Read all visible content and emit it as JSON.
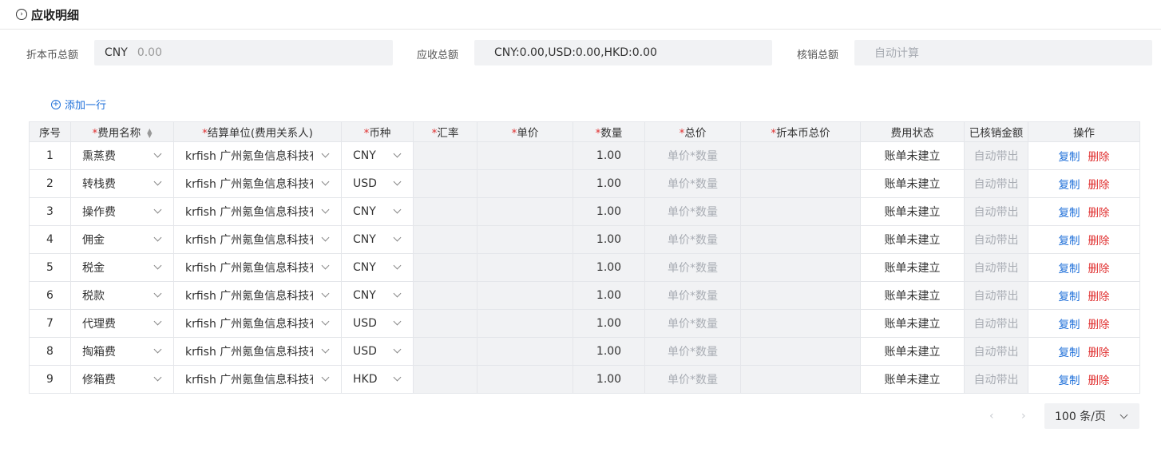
{
  "header": {
    "title": "应收明细"
  },
  "summary": {
    "base_total_label": "折本币总额",
    "base_total_currency": "CNY",
    "base_total_value": "0.00",
    "receivable_total_label": "应收总额",
    "receivable_total_value": "CNY:0.00,USD:0.00,HKD:0.00",
    "writeoff_total_label": "核销总额",
    "writeoff_total_placeholder": "自动计算"
  },
  "add_row_label": "添加一行",
  "table": {
    "columns": [
      {
        "label": "序号",
        "required": false
      },
      {
        "label": "费用名称",
        "required": true
      },
      {
        "label": "结算单位(费用关系人)",
        "required": true
      },
      {
        "label": "币种",
        "required": true
      },
      {
        "label": "汇率",
        "required": true
      },
      {
        "label": "单价",
        "required": true
      },
      {
        "label": "数量",
        "required": true
      },
      {
        "label": "总价",
        "required": true
      },
      {
        "label": "折本币总价",
        "required": true
      },
      {
        "label": "费用状态",
        "required": false
      },
      {
        "label": "已核销金额",
        "required": false
      },
      {
        "label": "操作",
        "required": false
      }
    ],
    "total_placeholder": "单价*数量",
    "writeoff_placeholder": "自动带出",
    "copy_label": "复制",
    "delete_label": "删除",
    "rows": [
      {
        "no": "1",
        "fee": "熏蒸费",
        "unit": "krfish 广州氪鱼信息科技有限公司",
        "currency": "CNY",
        "qty": "1.00",
        "status": "账单未建立"
      },
      {
        "no": "2",
        "fee": "转栈费",
        "unit": "krfish 广州氪鱼信息科技有限公司",
        "currency": "USD",
        "qty": "1.00",
        "status": "账单未建立"
      },
      {
        "no": "3",
        "fee": "操作费",
        "unit": "krfish 广州氪鱼信息科技有限公司",
        "currency": "CNY",
        "qty": "1.00",
        "status": "账单未建立"
      },
      {
        "no": "4",
        "fee": "佣金",
        "unit": "krfish 广州氪鱼信息科技有限公司",
        "currency": "CNY",
        "qty": "1.00",
        "status": "账单未建立"
      },
      {
        "no": "5",
        "fee": "税金",
        "unit": "krfish 广州氪鱼信息科技有限公司",
        "currency": "CNY",
        "qty": "1.00",
        "status": "账单未建立"
      },
      {
        "no": "6",
        "fee": "税款",
        "unit": "krfish 广州氪鱼信息科技有限公司",
        "currency": "CNY",
        "qty": "1.00",
        "status": "账单未建立"
      },
      {
        "no": "7",
        "fee": "代理费",
        "unit": "krfish 广州氪鱼信息科技有限公司",
        "currency": "USD",
        "qty": "1.00",
        "status": "账单未建立"
      },
      {
        "no": "8",
        "fee": "掏箱费",
        "unit": "krfish 广州氪鱼信息科技有限公司",
        "currency": "USD",
        "qty": "1.00",
        "status": "账单未建立"
      },
      {
        "no": "9",
        "fee": "修箱费",
        "unit": "krfish 广州氪鱼信息科技有限公司",
        "currency": "HKD",
        "qty": "1.00",
        "status": "账单未建立"
      }
    ]
  },
  "pagination": {
    "prev_icon": "chevron-left-icon",
    "next_icon": "chevron-right-icon",
    "page_size_label": "100 条/页"
  },
  "colors": {
    "accent": "#1e6fd9",
    "danger": "#e03030",
    "field_bg": "#f1f2f4"
  }
}
